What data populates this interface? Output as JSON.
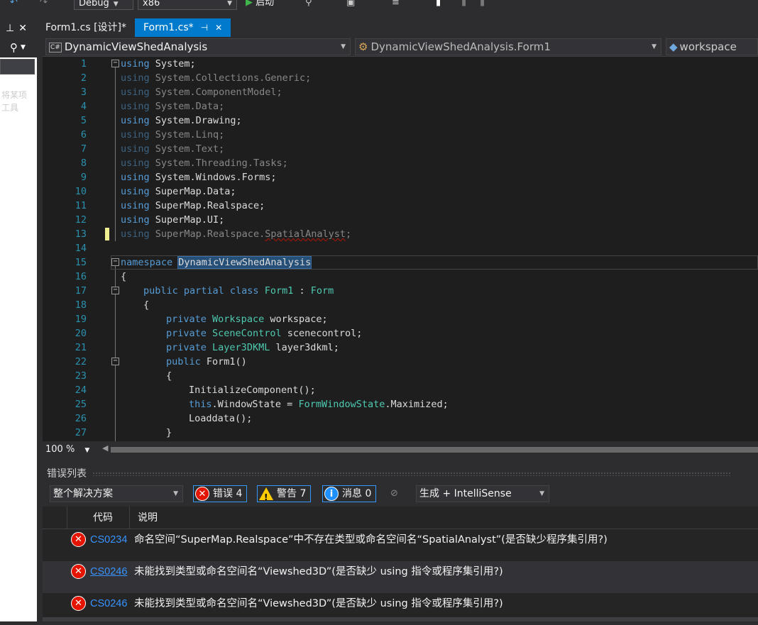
{
  "toolbar": {
    "config": "Debug",
    "platform": "x86",
    "start_label": "启动"
  },
  "left_panel": {
    "pin": "ᵖ",
    "close": "✕",
    "ghost_line1": "将某项",
    "ghost_line2": "工具"
  },
  "tabs": [
    {
      "label": "Form1.cs [设计]*"
    },
    {
      "label": "Form1.cs*"
    }
  ],
  "nav": {
    "project": "DynamicViewShedAnalysis",
    "class": "DynamicViewShedAnalysis.Form1",
    "member": "workspace"
  },
  "code_lines": [
    "1",
    "2",
    "3",
    "4",
    "5",
    "6",
    "7",
    "8",
    "9",
    "10",
    "11",
    "12",
    "13",
    "14",
    "15",
    "16",
    "17",
    "18",
    "19",
    "20",
    "21",
    "22",
    "23",
    "24",
    "25",
    "26",
    "27"
  ],
  "code": {
    "l1": [
      "using",
      " System;"
    ],
    "l2": [
      "using",
      " System.Collections.Generic;"
    ],
    "l3": [
      "using",
      " System.ComponentModel;"
    ],
    "l4": [
      "using",
      " System.Data;"
    ],
    "l5": [
      "using",
      " System.Drawing;"
    ],
    "l6": [
      "using",
      " System.Linq;"
    ],
    "l7": [
      "using",
      " System.Text;"
    ],
    "l8": [
      "using",
      " System.Threading.Tasks;"
    ],
    "l9": [
      "using",
      " System.Windows.Forms;"
    ],
    "l10": [
      "using",
      " SuperMap.Data;"
    ],
    "l11": [
      "using",
      " SuperMap.Realspace;"
    ],
    "l12": [
      "using",
      " SuperMap.UI;"
    ],
    "l13": [
      "using",
      " SuperMap.Realspace.",
      "SpatialAnalyst",
      ";"
    ],
    "l15": [
      "namespace",
      " ",
      "DynamicViewShedAnalysis"
    ],
    "l16": "{",
    "l17": [
      "public partial class",
      " ",
      "Form1",
      " : ",
      "Form"
    ],
    "l18": "{",
    "l19": [
      "private",
      " ",
      "Workspace",
      " workspace;"
    ],
    "l20": [
      "private",
      " ",
      "SceneControl",
      " scenecontrol;"
    ],
    "l21": [
      "private",
      " ",
      "Layer3DKML",
      " layer3dkml;"
    ],
    "l22": [
      "public",
      " Form1()"
    ],
    "l23": "{",
    "l24": "InitializeComponent();",
    "l25": [
      "this",
      ".WindowState = ",
      "FormWindowState",
      ".Maximized;"
    ],
    "l26": "Loaddata();",
    "l27": "}"
  },
  "zoom": "100 %",
  "error_list": {
    "title": "错误列表",
    "scope": "整个解决方案",
    "errors_label": "错误 4",
    "warnings_label": "警告 7",
    "messages_label": "消息 0",
    "build_filter": "生成 + IntelliSense",
    "col_code": "代码",
    "col_desc": "说明",
    "rows": [
      {
        "code": "CS0234",
        "desc": "命名空间“SuperMap.Realspace”中不存在类型或命名空间名“SpatialAnalyst”(是否缺少程序集引用?)"
      },
      {
        "code": "CS0246",
        "desc": "未能找到类型或命名空间名“Viewshed3D”(是否缺少 using 指令或程序集引用?)"
      },
      {
        "code": "CS0246",
        "desc": "未能找到类型或命名空间名“Viewshed3D”(是否缺少 using 指令或程序集引用?)"
      }
    ]
  },
  "colors": {
    "accent": "#007acc",
    "editor_bg": "#1e1e1e",
    "keyword": "#569cd6",
    "type": "#4ec9b0",
    "line_number": "#2b91af",
    "error": "#e51400",
    "warning": "#ffcc00",
    "info": "#1e90ff"
  }
}
